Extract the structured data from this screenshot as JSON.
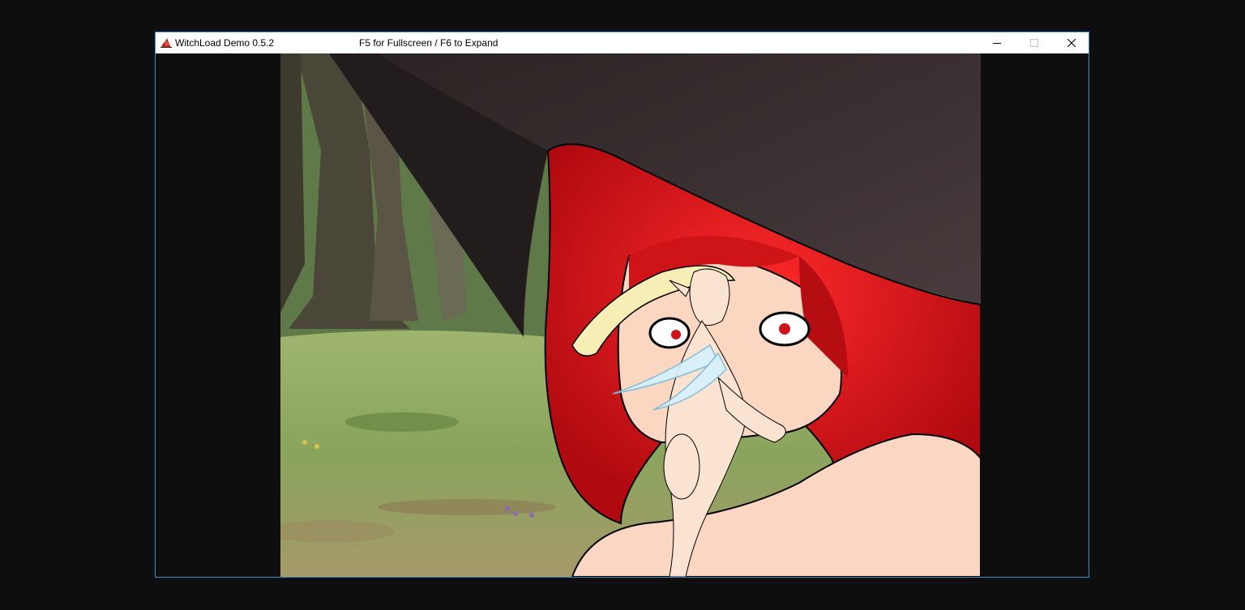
{
  "window": {
    "title": "WitchLoad Demo 0.5.2",
    "hint": "F5 for Fullscreen / F6 to Expand",
    "controls": {
      "minimize_icon": "minimize-icon",
      "maximize_icon": "maximize-icon",
      "close_icon": "close-icon"
    },
    "app_icon": "witch-hat-icon"
  },
  "colors": {
    "frame_border": "#3a8fc7",
    "desktop_bg": "#0e0e0e",
    "witch_hair": "#d8141a",
    "witch_hat": "#3e3335",
    "fairy_hair": "#f5e9a8"
  },
  "scene": {
    "description_icon": "game-scene"
  }
}
